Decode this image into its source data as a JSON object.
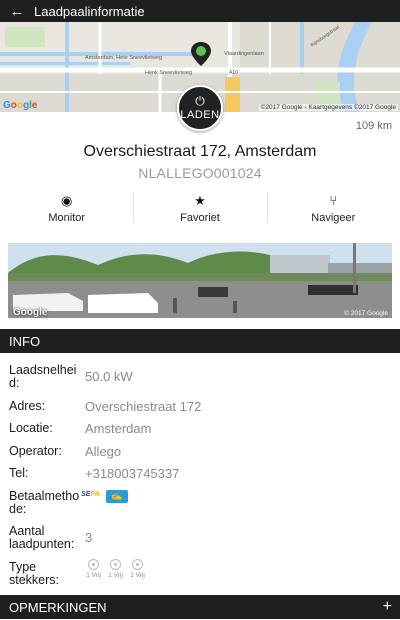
{
  "header": {
    "title": "Laadpaalinformatie",
    "back_icon": "arrow-left-icon"
  },
  "map": {
    "labels": [
      "Amsterdam, Hete Sneevlietweg",
      "Vlaardingenlaan",
      "Henk Sneevlietweg",
      "A10",
      "Rijnsburgstraat"
    ],
    "attribution": "©2017 Google - Kaartgegevens ©2017 Google",
    "google": [
      "G",
      "o",
      "o",
      "g",
      "l",
      "e"
    ]
  },
  "laden": {
    "label": "LADEN",
    "icon": "plug-icon"
  },
  "distance": "109 km",
  "address": "Overschiestraat 172, Amsterdam",
  "station_code": "NLALLEGO001024",
  "actions": [
    {
      "label": "Monitor",
      "icon": "eye-icon"
    },
    {
      "label": "Favoriet",
      "icon": "star-icon"
    },
    {
      "label": "Navigeer",
      "icon": "directions-icon"
    }
  ],
  "streetview": {
    "copyright": "© 2017 Google",
    "google": "Google"
  },
  "info_section": {
    "title": "INFO"
  },
  "info": {
    "speed": {
      "key": "Laadsnelheid:",
      "value": "50.0 kW"
    },
    "adres": {
      "key": "Adres:",
      "value": "Overschiestraat 172"
    },
    "locatie": {
      "key": "Locatie:",
      "value": "Amsterdam"
    },
    "operator": {
      "key": "Operator:",
      "value": "Allego"
    },
    "tel": {
      "key": "Tel:",
      "value": "+318003745337"
    },
    "betaal": {
      "key": "Betaalmethode:",
      "sepa_a": "SE",
      "sepa_b": "PA",
      "card_icon": "card-icon"
    },
    "aantal": {
      "key": "Aantal laadpunten:",
      "value": "3"
    },
    "stekkers": {
      "key": "Type stekkers:",
      "items": [
        "1 Vrij",
        "1 Vrij",
        "1 Vrij"
      ]
    }
  },
  "opmerkingen": {
    "title": "OPMERKINGEN",
    "expand": "+"
  }
}
